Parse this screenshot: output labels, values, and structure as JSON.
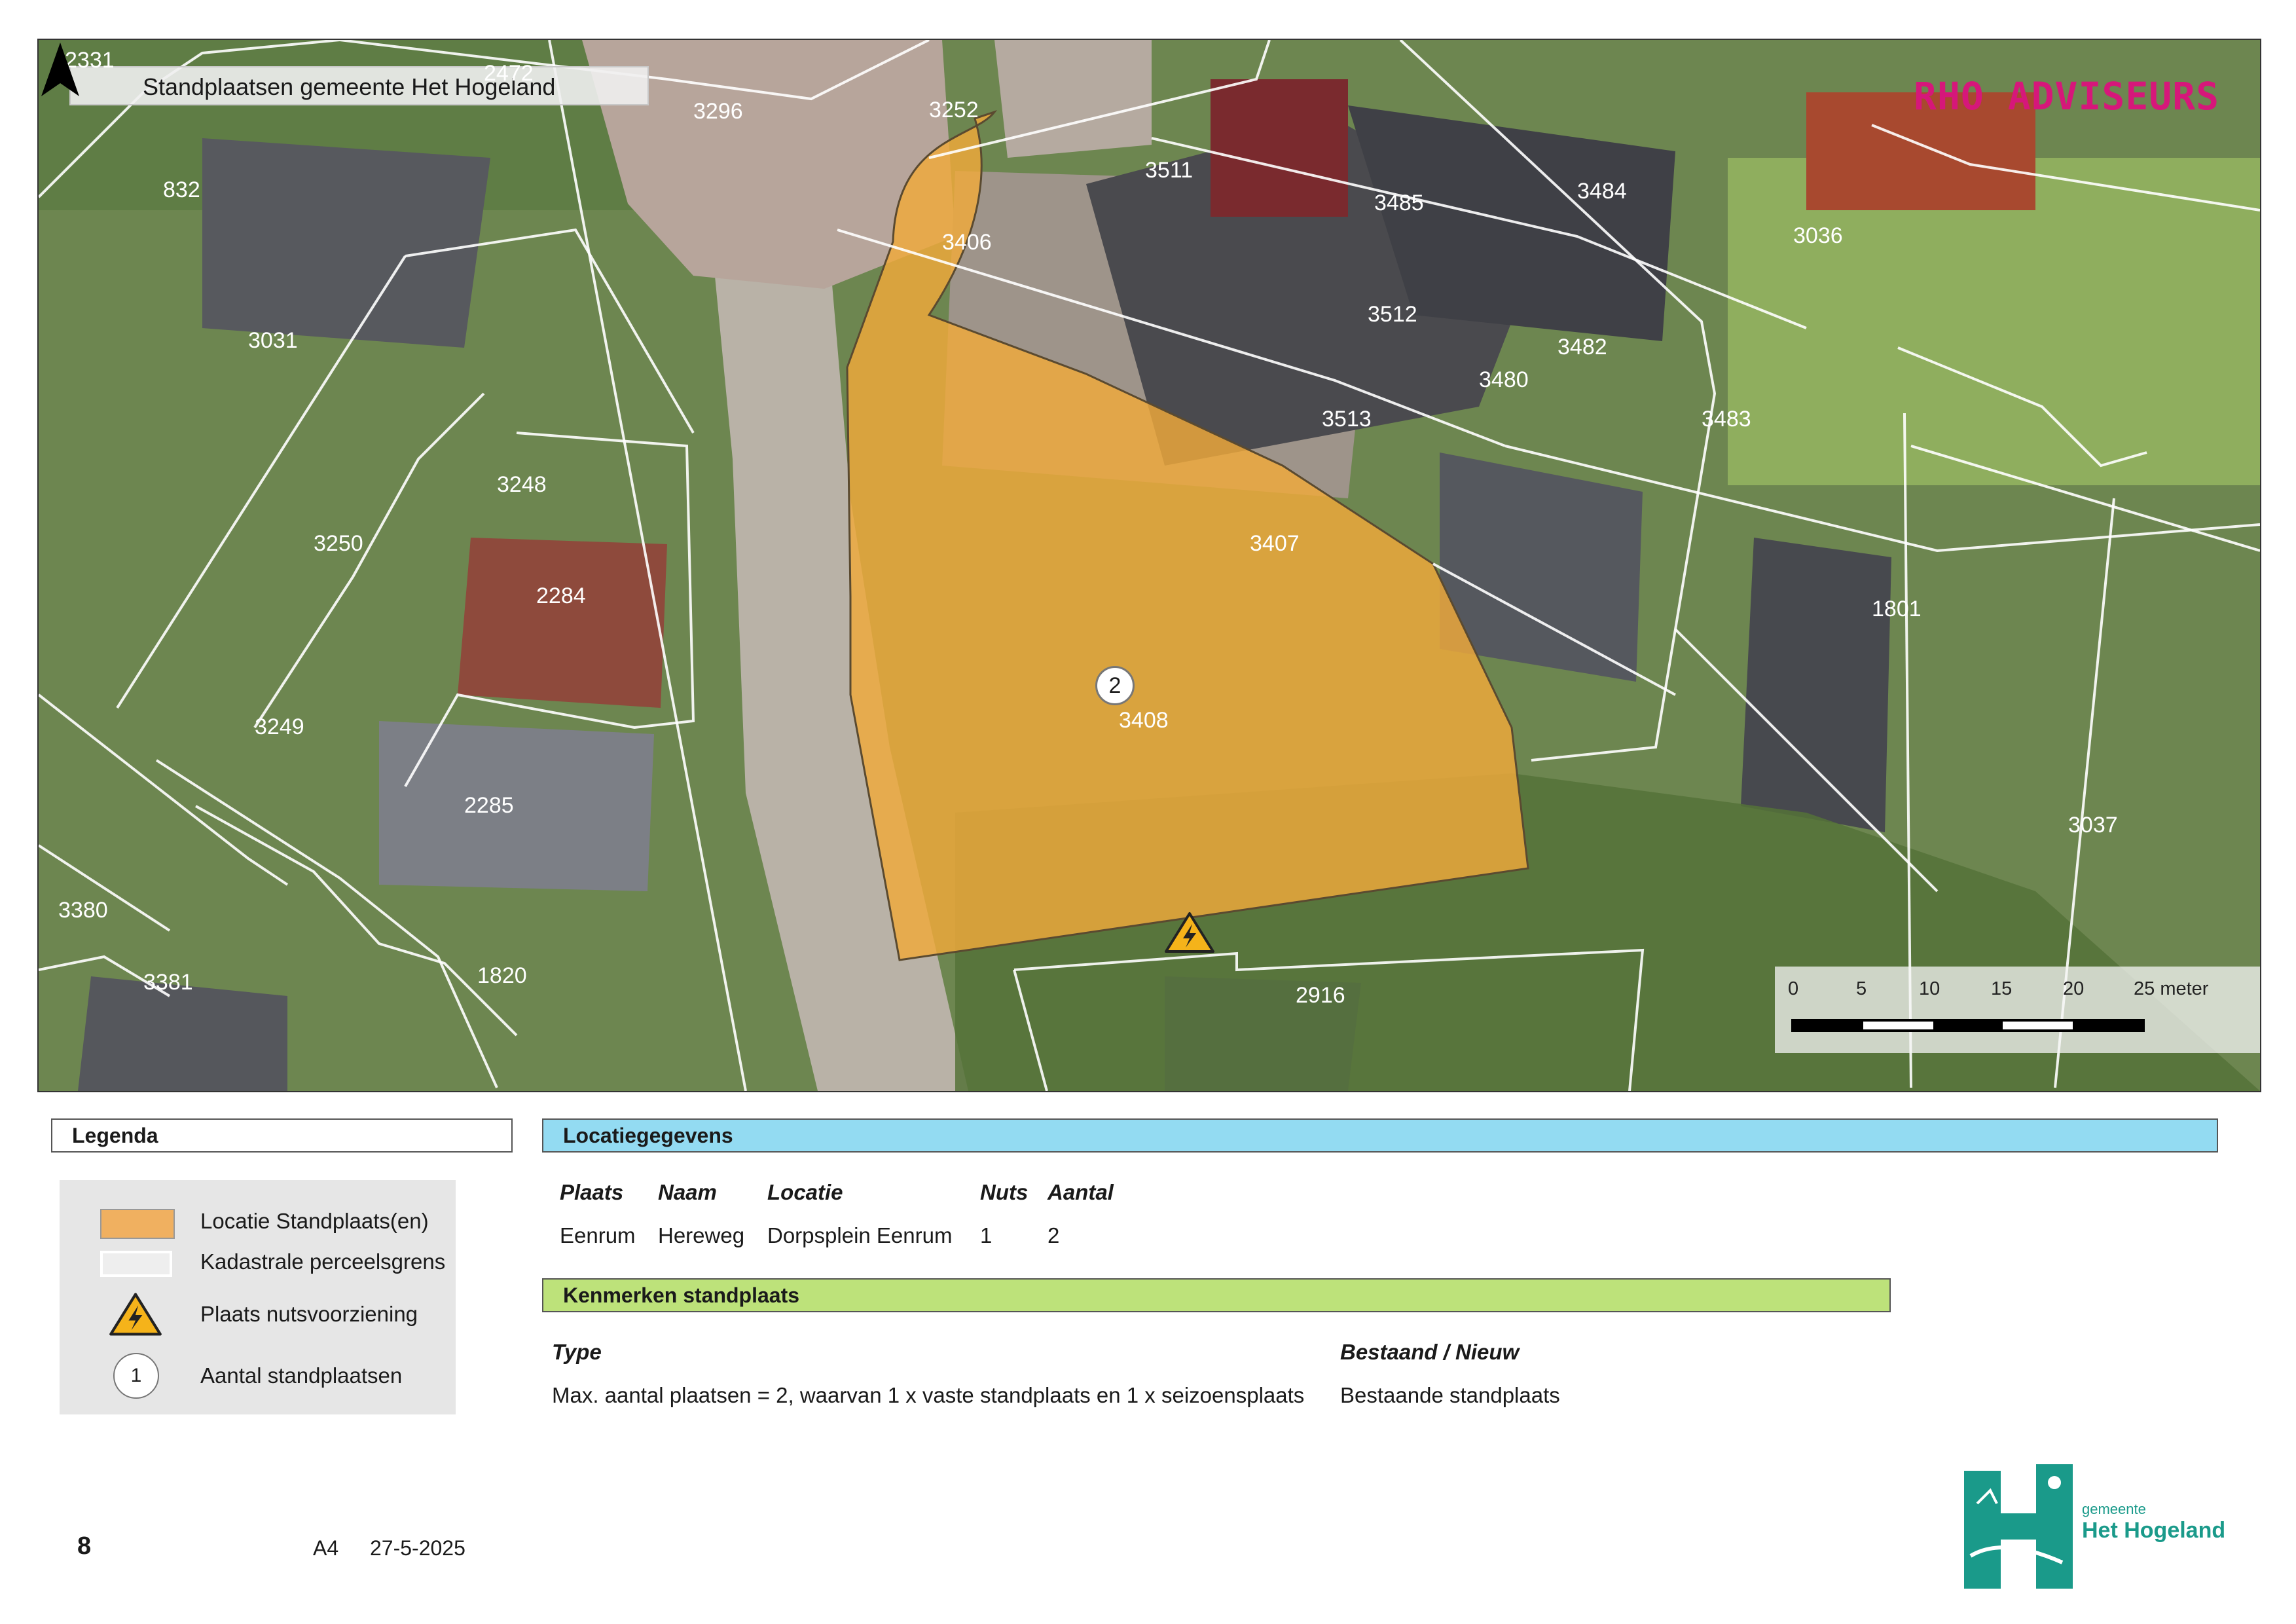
{
  "map": {
    "title": "Standplaatsen gemeente Het Hogeland",
    "brand": "RHO ADVISEURS",
    "parcel_labels": [
      "2331",
      "2472",
      "3296",
      "3252",
      "832",
      "3511",
      "3485",
      "3484",
      "3036",
      "3406",
      "3031",
      "3512",
      "3482",
      "3480",
      "3483",
      "3513",
      "3248",
      "3250",
      "3407",
      "2284",
      "1801",
      "2",
      "3408",
      "3249",
      "2285",
      "3037",
      "3380",
      "3381",
      "1820",
      "2916"
    ],
    "standplaats_count": "2",
    "colors": {
      "location_fill": "#f0a93a",
      "parcel_line": "#ffffff",
      "brand": "#d6177a"
    }
  },
  "scale": {
    "ticks": [
      "0",
      "5",
      "10",
      "15",
      "20",
      "25 meter"
    ]
  },
  "legend": {
    "title": "Legenda",
    "items": [
      {
        "icon": "orange-area-icon",
        "label": "Locatie Standplaats(en)"
      },
      {
        "icon": "parcel-boundary-icon",
        "label": "Kadastrale perceelsgrens"
      },
      {
        "icon": "warning-electric-icon",
        "label": "Plaats nutsvoorziening"
      },
      {
        "icon": "count-circle-icon",
        "symbol": "1",
        "label": "Aantal standplaatsen"
      }
    ]
  },
  "location": {
    "title": "Locatiegegevens",
    "headers": [
      "Plaats",
      "Naam",
      "Locatie",
      "Nuts",
      "Aantal"
    ],
    "row": [
      "Eenrum",
      "Hereweg",
      "Dorpsplein Eenrum",
      "1",
      "2"
    ]
  },
  "features": {
    "title": "Kenmerken standplaats",
    "headers": [
      "Type",
      "Bestaand / Nieuw"
    ],
    "row": [
      "Max. aantal plaatsen = 2, waarvan 1 x vaste standplaats en 1 x seizoensplaats",
      "Bestaande standplaats"
    ]
  },
  "footer": {
    "page_number": "8",
    "paper": "A4",
    "date": "27-5-2025"
  },
  "logo": {
    "line1": "gemeente",
    "line2": "Het Hogeland"
  }
}
